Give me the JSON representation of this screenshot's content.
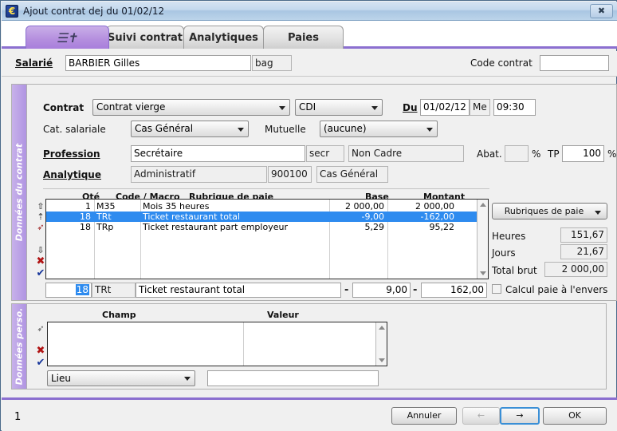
{
  "window": {
    "title": "Ajout contrat dej du 01/02/12",
    "icon": "euro-app-icon",
    "close_label": "✖"
  },
  "tabs": [
    {
      "label": "",
      "icon": "contract-quill-icon",
      "active": true
    },
    {
      "label": "Suivi contrat",
      "active": false
    },
    {
      "label": "Analytiques",
      "active": false
    },
    {
      "label": "Paies",
      "active": false
    }
  ],
  "header": {
    "salarie_label": "Salarié",
    "salarie_value": "BARBIER Gilles",
    "salarie_code": "bag",
    "code_contrat_label": "Code contrat",
    "code_contrat_value": ""
  },
  "contract_panel": {
    "strip_label": "Données du contrat",
    "contrat_label": "Contrat",
    "contrat_value": "Contrat vierge",
    "type_value": "CDI",
    "du_label": "Du",
    "du_value": "01/02/12",
    "jour_value": "Me",
    "heure_value": "09:30",
    "cat_label": "Cat. salariale",
    "cat_value": "Cas Général",
    "mutuelle_label": "Mutuelle",
    "mutuelle_value": "(aucune)",
    "profession_label": "Profession",
    "profession_value": "Secrétaire",
    "profession_code": "secr",
    "profession_statut": "Non Cadre",
    "abat_label": "Abat.",
    "abat_value": "",
    "abat_pct": "%",
    "tp_label": "TP",
    "tp_value": "100",
    "tp_pct": "%",
    "analytique_label": "Analytique",
    "analytique_value": "Administratif",
    "analytique_code": "900100",
    "analytique_cat": "Cas Général"
  },
  "grid": {
    "columns": [
      "Qté",
      "Code / Macro",
      "Rubrique de paie",
      "Base",
      "Montant"
    ],
    "rows": [
      {
        "qte": "1",
        "code": "M35",
        "rubrique": "Mois 35 heures",
        "base": "2 000,00",
        "montant": "2 000,00",
        "selected": false
      },
      {
        "qte": "18",
        "code": "TRt",
        "rubrique": "Ticket restaurant total",
        "base": "-9,00",
        "montant": "-162,00",
        "selected": true
      },
      {
        "qte": "18",
        "code": "TRp",
        "rubrique": "Ticket restaurant part employeur",
        "base": "5,29",
        "montant": "95,22",
        "selected": false
      }
    ],
    "row_icons": [
      "up-double-icon",
      "up-single-icon",
      "red-flag-icon",
      "down-icon",
      "delete-cross-icon",
      "validate-check-icon"
    ],
    "edit_row": {
      "qte": "18",
      "code": "TRt",
      "rubrique": "Ticket restaurant total",
      "base": "9,00",
      "montant": "162,00",
      "sep": "-"
    }
  },
  "side_panel": {
    "rubriques_button": "Rubriques de paie",
    "heures_label": "Heures",
    "heures_value": "151,67",
    "jours_label": "Jours",
    "jours_value": "21,67",
    "total_label": "Total brut",
    "total_value": "2 000,00",
    "checkbox_label": "Calcul paie à l'envers",
    "checkbox_checked": false
  },
  "perso_panel": {
    "strip_label": "Données perso.",
    "columns": [
      "Champ",
      "Valeur"
    ],
    "rows": [],
    "row_icons": [
      "red-flag-icon",
      "delete-cross-icon",
      "validate-check-icon"
    ],
    "field_select_value": "Lieu",
    "field_value": ""
  },
  "footer": {
    "page_number": "1",
    "cancel_label": "Annuler",
    "prev_label": "←",
    "next_label": "→",
    "ok_label": "OK"
  },
  "colors": {
    "accent_purple": "#8b6fd0",
    "selection_blue": "#2e8bef",
    "panel_bg": "#f0f0f0",
    "title_blue": "#bcd4ea"
  }
}
